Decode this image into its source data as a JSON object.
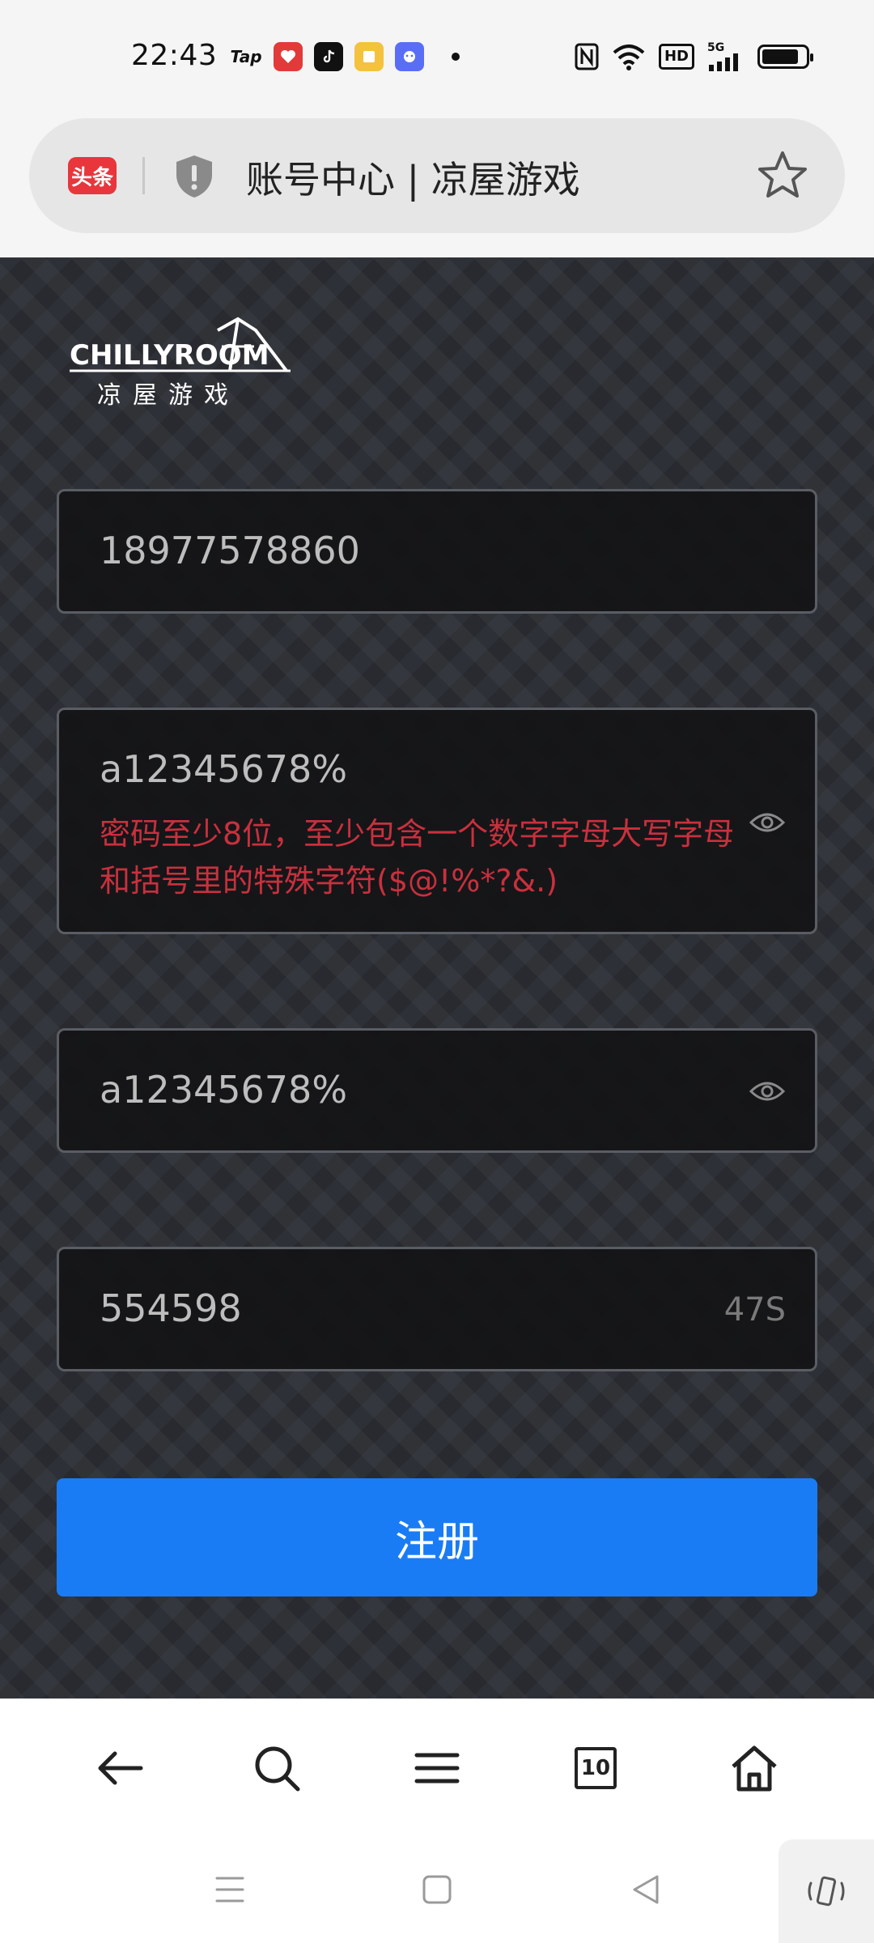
{
  "status_bar": {
    "time": "22:43",
    "notification_apps": [
      "tap-icon",
      "red-app-icon",
      "tiktok-icon",
      "yellow-app-icon",
      "blue-app-icon"
    ],
    "tap_label": "Tap",
    "network": "5G",
    "hd_label": "HD",
    "battery_level": 0.85
  },
  "address_bar": {
    "site_badge": "头条",
    "title": "账号中心 | 凉屋游戏"
  },
  "logo": {
    "brand_en": "CHILLYROOM",
    "brand_cn": "凉屋游戏"
  },
  "form": {
    "phone_value": "18977578860",
    "password_value": "a12345678%",
    "password_error": "密码至少8位，至少包含一个数字字母大写字母和括号里的特殊字符($@!%*?&.)",
    "confirm_password_value": "a12345678%",
    "code_value": "554598",
    "countdown": "47S",
    "register_label": "注册"
  },
  "browser_toolbar": {
    "tabs_count": "10"
  },
  "colors": {
    "accent": "#1a7cf5",
    "error": "#c9303d",
    "background": "#2d3036"
  }
}
